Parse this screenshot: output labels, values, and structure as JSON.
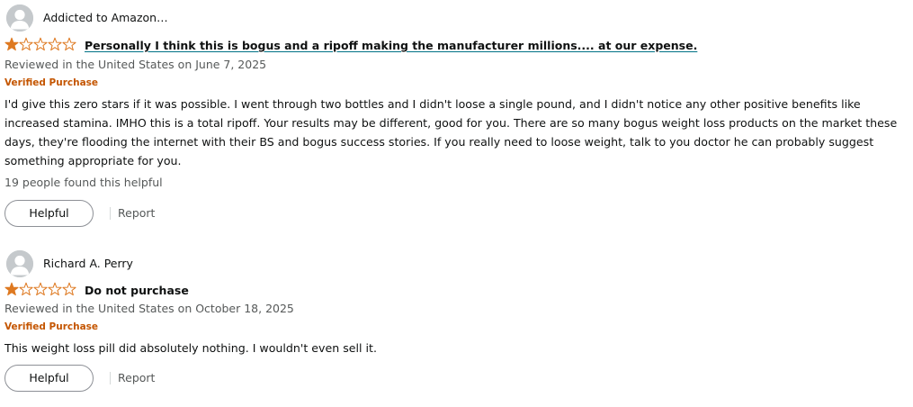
{
  "theme": {
    "star_color": "#de7921",
    "verified_color": "#c45500",
    "link_underline_color": "#007185",
    "muted_text_color": "#565959"
  },
  "reviews": [
    {
      "profile_name": "Addicted to Amazon…",
      "avatar_icon": "default-user-avatar-icon",
      "rating": 1,
      "rating_max": 5,
      "title": "Personally I think this is bogus and a ripoff making the manufacturer millions.... at our expense.",
      "date_text": "Reviewed in the United States on June 7, 2025",
      "verified_label": "Verified Purchase",
      "body": "I'd give this zero stars if it was possible. I went through two bottles and I didn't loose a single pound, and I didn't notice any other positive benefits like increased stamina. IMHO this is a total ripoff. Your results may be different, good for you. There are so many bogus weight loss products on the market these days, they're flooding the internet with their BS and bogus success stories. If you really need to loose weight, talk to you doctor he can probably suggest something appropriate for you.",
      "helpful_count_text": "19 people found this helpful",
      "helpful_button_label": "Helpful",
      "report_label": "Report"
    },
    {
      "profile_name": "Richard A. Perry",
      "avatar_icon": "default-user-avatar-icon",
      "rating": 1,
      "rating_max": 5,
      "title": "Do not purchase",
      "date_text": "Reviewed in the United States on October 18, 2025",
      "verified_label": "Verified Purchase",
      "body": "This weight loss pill did absolutely nothing. I wouldn't even sell it.",
      "helpful_button_label": "Helpful",
      "report_label": "Report"
    }
  ]
}
